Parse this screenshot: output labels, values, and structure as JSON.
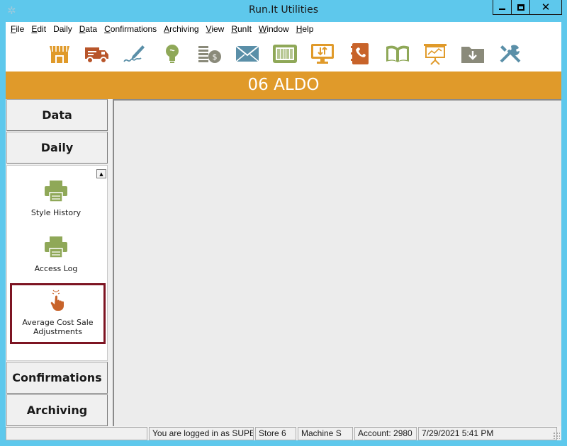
{
  "window": {
    "title": "Run.It Utilities",
    "icon": "app-icon"
  },
  "menu": [
    {
      "label": "File",
      "accel": "F",
      "rest": "ile"
    },
    {
      "label": "Edit",
      "accel": "E",
      "rest": "dit"
    },
    {
      "label": "Daily",
      "accel": "",
      "rest": "Daily"
    },
    {
      "label": "Data",
      "accel": "D",
      "rest": "ata"
    },
    {
      "label": "Confirmations",
      "accel": "C",
      "rest": "onfirmations"
    },
    {
      "label": "Archiving",
      "accel": "A",
      "rest": "rchiving"
    },
    {
      "label": "View",
      "accel": "V",
      "rest": "iew"
    },
    {
      "label": "RunIt",
      "accel": "R",
      "rest": "unIt"
    },
    {
      "label": "Window",
      "accel": "W",
      "rest": "indow"
    },
    {
      "label": "Help",
      "accel": "H",
      "rest": "elp"
    }
  ],
  "toolbar": [
    "store-icon",
    "truck-icon",
    "signature-icon",
    "lightbulb-icon",
    "coins-icon",
    "envelope-icon",
    "barcode-icon",
    "transfer-monitor-icon",
    "phone-book-icon",
    "open-book-icon",
    "presentation-icon",
    "download-folder-icon",
    "tools-icon"
  ],
  "colors": {
    "banner": "#e09a2a",
    "selection_border": "#7d1422",
    "icon_green": "#8fa858",
    "icon_orange": "#c8632a"
  },
  "banner": {
    "text": "06 ALDO"
  },
  "sidebar": {
    "top_buttons": [
      "Data",
      "Daily"
    ],
    "items": [
      {
        "label": "Style History",
        "icon": "printer-icon"
      },
      {
        "label": "Access Log",
        "icon": "printer-icon"
      },
      {
        "label": "Average Cost Sale Adjustments",
        "icon": "pointing-hand-icon",
        "selected": true
      }
    ],
    "bottom_buttons": [
      "Confirmations",
      "Archiving"
    ]
  },
  "status": {
    "blank": "",
    "login": "You are logged in as SUPER",
    "store": "Store 6",
    "machine": "Machine S",
    "account": "Account: 2980",
    "datetime": "7/29/2021 5:41 PM"
  }
}
